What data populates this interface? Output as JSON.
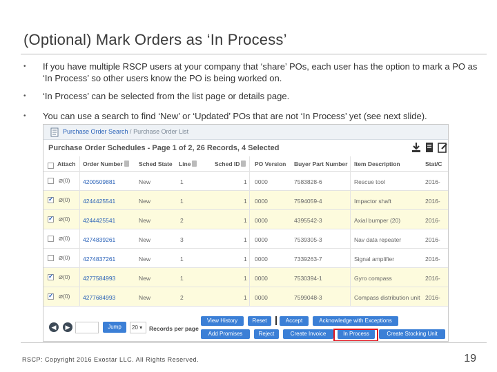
{
  "slide": {
    "title": "(Optional) Mark Orders as ‘In Process’",
    "bullets": [
      "If you have multiple RSCP users at your company that ‘share’ POs, each user has the option to mark a PO as ‘In Process’ so other users know the PO is being worked on.",
      "‘In Process’ can be selected from the list page or details page.",
      "You can use a search to find ‘New’ or ‘Updated’ POs that are not ‘In Process’ yet (see next slide)."
    ],
    "bullet_glyph": "•",
    "copyright": "RSCP: Copyright 2016 Exostar LLC. All Rights Reserved.",
    "page_number": "19"
  },
  "app": {
    "breadcrumb": {
      "link": "Purchase Order Search",
      "separator": " / ",
      "current": "Purchase Order List"
    },
    "grid_title": "Purchase Order Schedules - Page 1 of 2, 26 Records, 4 Selected",
    "toolbar_icons": [
      "download-icon",
      "print-icon",
      "edit-icon"
    ],
    "columns": [
      "Attach",
      "Order Number",
      "Sched State",
      "Line",
      "Sched ID",
      "PO Version",
      "Buyer Part Number",
      "Item Description",
      "Stat/C"
    ],
    "rows": [
      {
        "selected": false,
        "attach": "(0)",
        "order": "4200509881",
        "state": "New",
        "line": "1",
        "sched": "1",
        "version": "0000",
        "part": "7583828-6",
        "desc": "Rescue tool",
        "stat": "2016-"
      },
      {
        "selected": true,
        "attach": "(0)",
        "order": "4244425541",
        "state": "New",
        "line": "1",
        "sched": "1",
        "version": "0000",
        "part": "7594059-4",
        "desc": "Impactor shaft",
        "stat": "2016-"
      },
      {
        "selected": true,
        "attach": "(0)",
        "order": "4244425541",
        "state": "New",
        "line": "2",
        "sched": "1",
        "version": "0000",
        "part": "4395542-3",
        "desc": "Axial bumper (20)",
        "stat": "2016-"
      },
      {
        "selected": false,
        "attach": "(0)",
        "order": "4274839261",
        "state": "New",
        "line": "3",
        "sched": "1",
        "version": "0000",
        "part": "7539305-3",
        "desc": "Nav data repeater",
        "stat": "2016-"
      },
      {
        "selected": false,
        "attach": "(0)",
        "order": "4274837261",
        "state": "New",
        "line": "1",
        "sched": "1",
        "version": "0000",
        "part": "7339263-7",
        "desc": "Signal amplifier",
        "stat": "2016-"
      },
      {
        "selected": true,
        "attach": "(0)",
        "order": "4277584993",
        "state": "New",
        "line": "1",
        "sched": "1",
        "version": "0000",
        "part": "7530394-1",
        "desc": "Gyro compass",
        "stat": "2016-"
      },
      {
        "selected": true,
        "attach": "(0)",
        "order": "4277684993",
        "state": "New",
        "line": "2",
        "sched": "1",
        "version": "0000",
        "part": "7599048-3",
        "desc": "Compass distribution unit",
        "stat": "2016-"
      }
    ],
    "footer": {
      "prev": "◀",
      "next": "▶",
      "jump": "Jump",
      "rpp_value": "20 ▾",
      "rpp_label": "Records per page",
      "buttons_top": [
        "View History",
        "Reset",
        "Accept",
        "Acknowledge with Exceptions"
      ],
      "buttons_bottom": [
        "Add Promises",
        "Reject",
        "Create Invoice",
        "In Process",
        "Create Stocking Unit"
      ]
    },
    "colors": {
      "link": "#2a62b8",
      "button": "#3b7fd6",
      "selected_row": "#fdfbdd",
      "highlight": "#e0141e"
    }
  }
}
